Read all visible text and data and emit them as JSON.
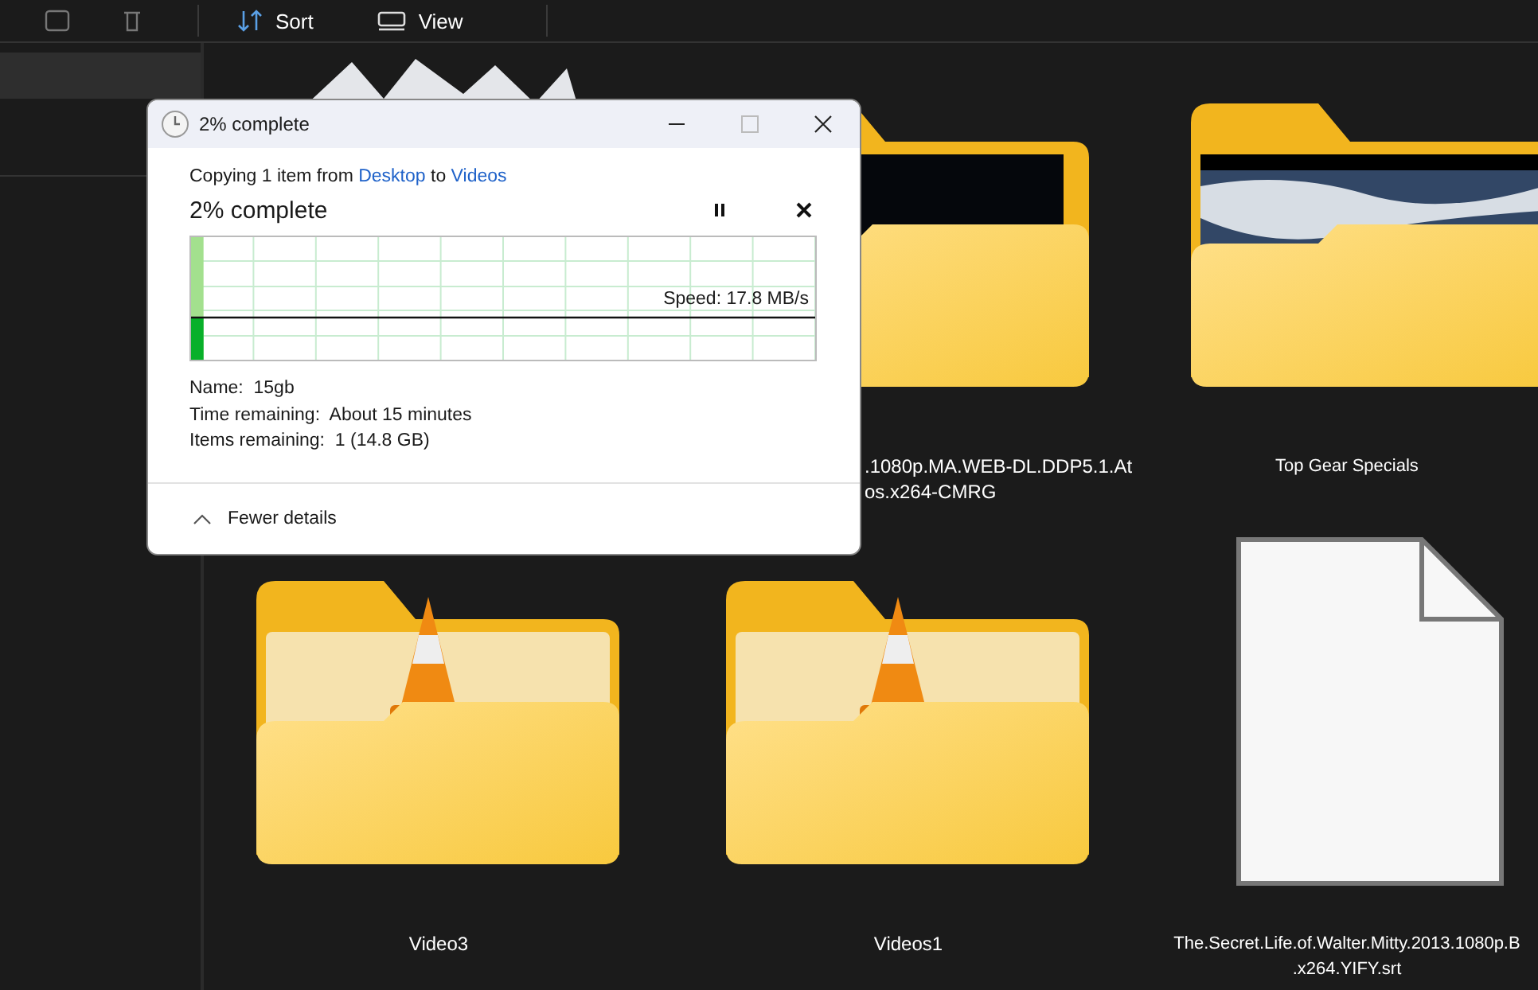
{
  "toolbar": {
    "buttons": [
      {
        "kind": "sort",
        "label": "Sort"
      },
      {
        "kind": "view",
        "label": "View"
      }
    ]
  },
  "items": [
    {
      "kind": "folder-papers"
    },
    {
      "kind": "folder-night",
      "label_lines": [
        ".1080p.MA.WEB-DL.DDP5.1.At",
        "os.x264-CMRG"
      ]
    },
    {
      "kind": "folder-landscape",
      "label_lines": [
        "Top Gear Specials"
      ]
    },
    {
      "kind": "folder-cone",
      "label_lines": [
        "Video3"
      ]
    },
    {
      "kind": "folder-cone",
      "label_lines": [
        "Videos1"
      ]
    },
    {
      "kind": "file",
      "label_lines": [
        "The.Secret.Life.of.Walter.Mitty.2013.1080p.B",
        ".x264.YIFY.srt"
      ]
    }
  ],
  "dialog": {
    "title": "2% complete",
    "copy_line": [
      {
        "text": "Copying 1 item from",
        "link": false
      },
      {
        "text": "Desktop",
        "link": true
      },
      {
        "text": "to",
        "link": false
      },
      {
        "text": "Videos",
        "link": true
      }
    ],
    "heading": "2% complete",
    "progress": {
      "level": 0.02,
      "speed": "Speed: 17.8 MB/s"
    },
    "details": [
      "Name:  15gb",
      "Time remaining:  About 15 minutes",
      "Items remaining:  1 (14.8 GB)"
    ],
    "toggle": {
      "label": "Fewer details",
      "expanded": true
    }
  }
}
